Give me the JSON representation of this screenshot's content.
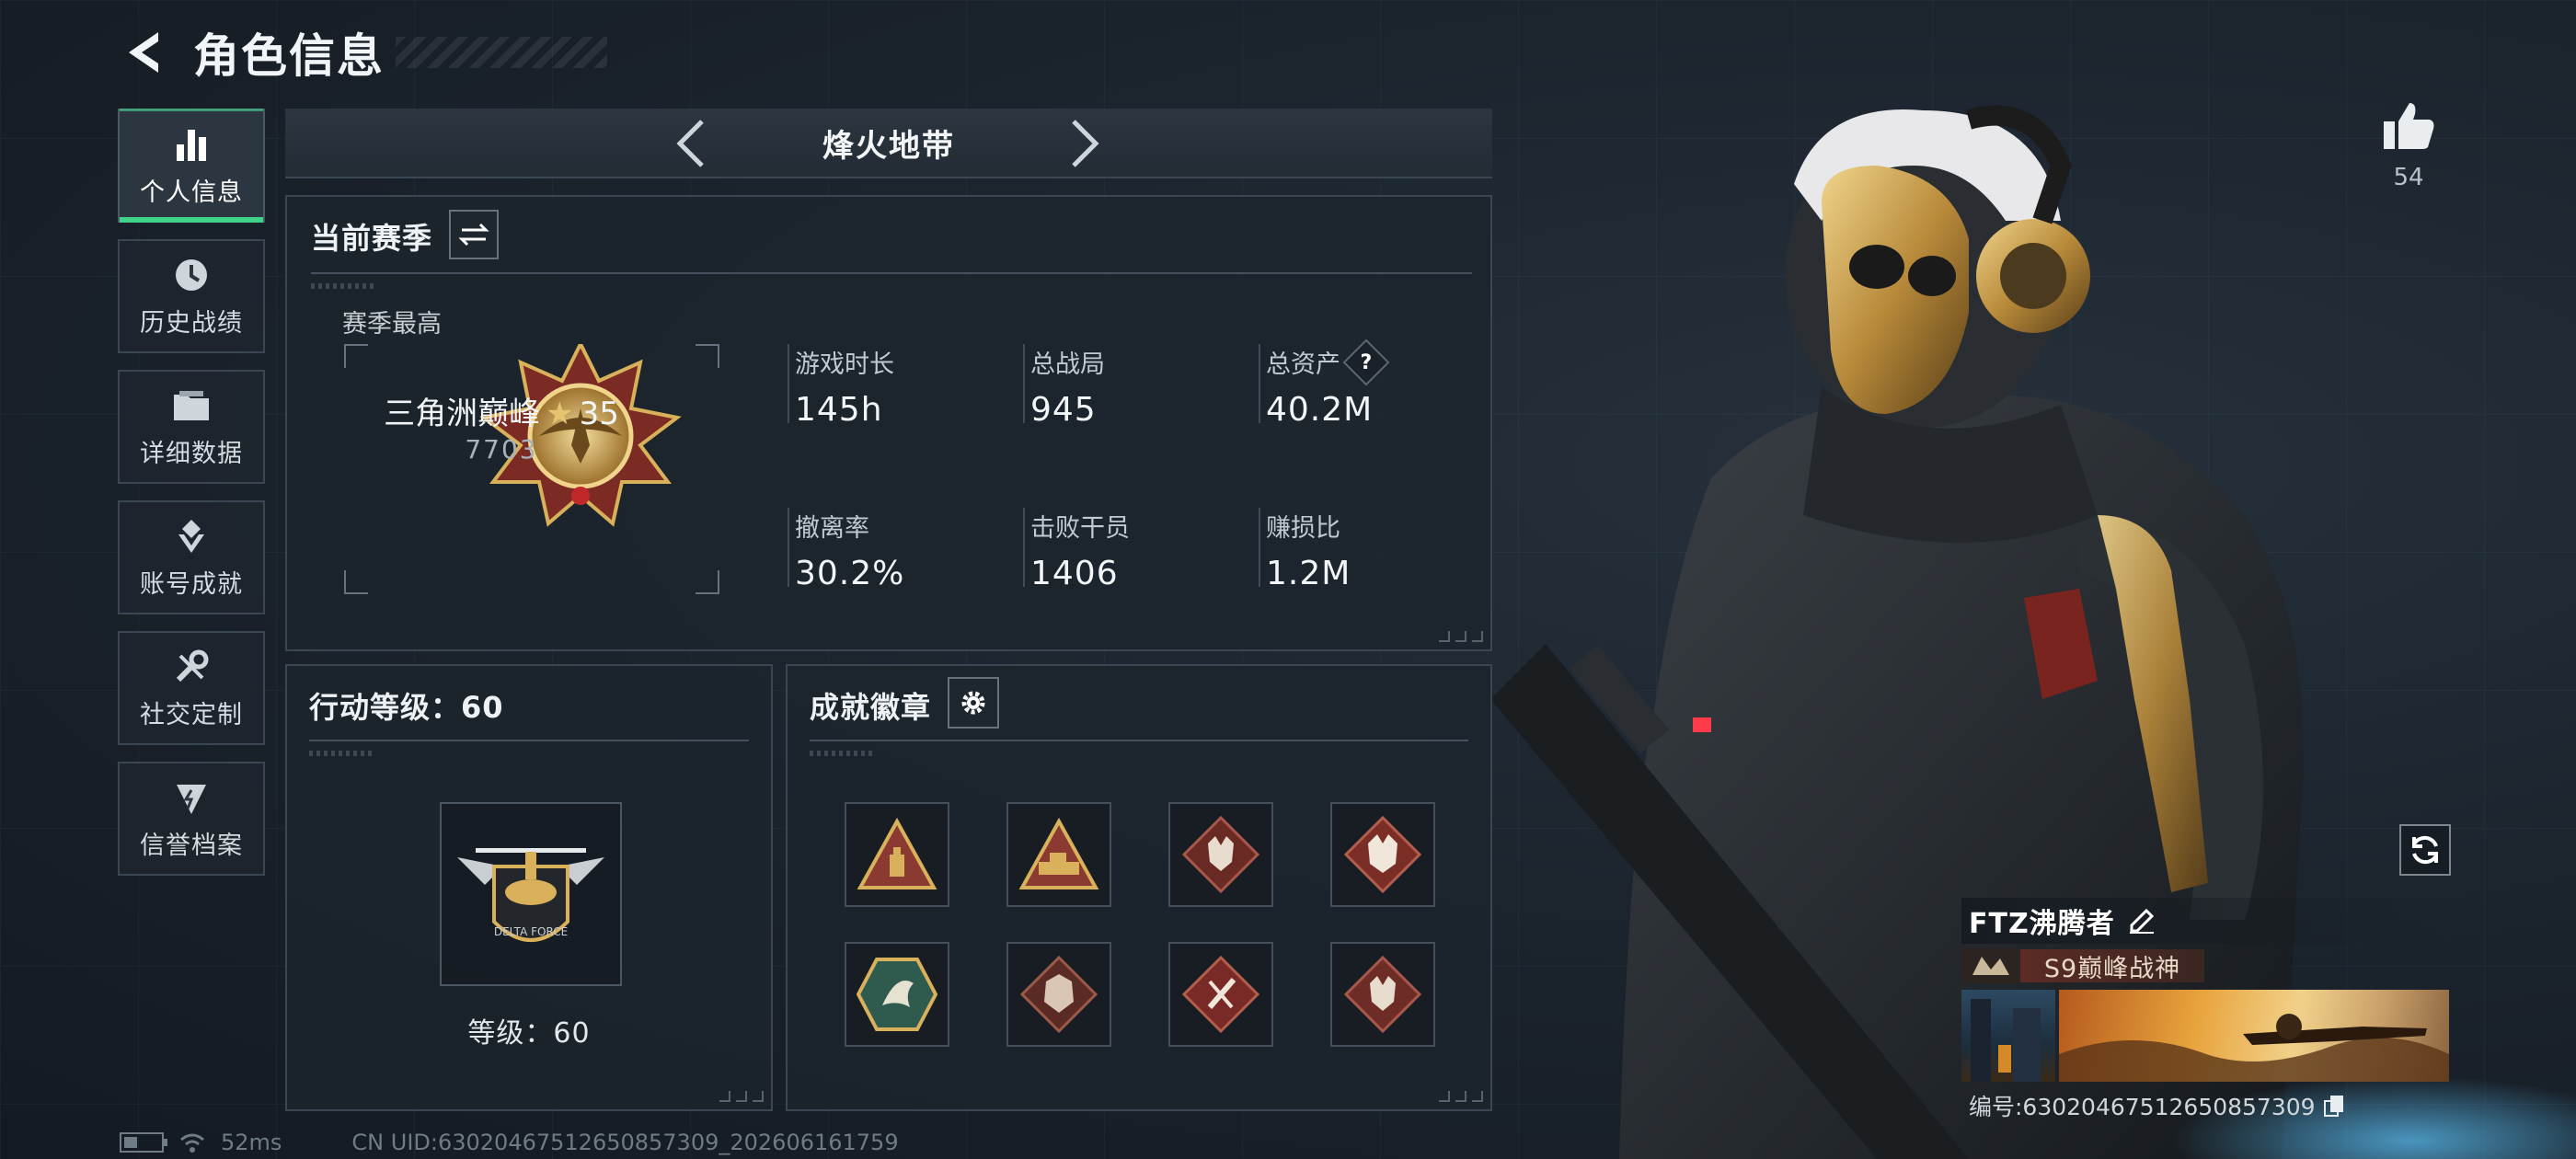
{
  "header": {
    "title": "角色信息"
  },
  "sidebar": {
    "items": [
      {
        "label": "个人信息",
        "icon": "bar-chart-icon",
        "active": true
      },
      {
        "label": "历史战绩",
        "icon": "history-clock-icon",
        "active": false
      },
      {
        "label": "详细数据",
        "icon": "folder-icon",
        "active": false
      },
      {
        "label": "账号成就",
        "icon": "achievement-icon",
        "active": false
      },
      {
        "label": "社交定制",
        "icon": "wrench-icon",
        "active": false
      },
      {
        "label": "信誉档案",
        "icon": "credit-shield-icon",
        "active": false
      }
    ]
  },
  "mode": {
    "title": "烽火地带"
  },
  "season": {
    "title": "当前赛季",
    "best_label": "赛季最高",
    "rank_name": "三角洲巅峰",
    "rank_stars": "35",
    "rank_score": "7703",
    "stats": [
      {
        "label": "游戏时长",
        "value": "145h"
      },
      {
        "label": "总战局",
        "value": "945"
      },
      {
        "label": "总资产",
        "value": "40.2M",
        "help": "?"
      },
      {
        "label": "撤离率",
        "value": "30.2%"
      },
      {
        "label": "击败干员",
        "value": "1406"
      },
      {
        "label": "赚损比",
        "value": "1.2M"
      }
    ]
  },
  "level": {
    "title": "行动等级：60",
    "label": "等级：60",
    "emblem_text": "DELTA FORCE"
  },
  "achievements": {
    "title": "成就徽章",
    "badges": [
      {
        "icon": "triangle-badge-icon"
      },
      {
        "icon": "vehicle-triangle-badge-icon"
      },
      {
        "icon": "wolf-diamond-badge-icon"
      },
      {
        "icon": "wolf-diamond-badge-icon"
      },
      {
        "icon": "dragon-hexagon-badge-icon"
      },
      {
        "icon": "dragon-diamond-badge-icon"
      },
      {
        "icon": "blade-diamond-badge-icon"
      },
      {
        "icon": "wolf-diamond-badge-icon"
      }
    ]
  },
  "character": {
    "likes": "54",
    "player_name": "FTZ沸腾者",
    "player_title": "S9巅峰战神",
    "player_id": "编号:6302046751265085730​9"
  },
  "footer": {
    "ping": "52ms",
    "uid": "CN UID:6302046751265085730​9_202606161759"
  },
  "colors": {
    "accent_green": "#3fd38a",
    "gold": "#d8b15a",
    "badge_red": "#8a3a30"
  }
}
